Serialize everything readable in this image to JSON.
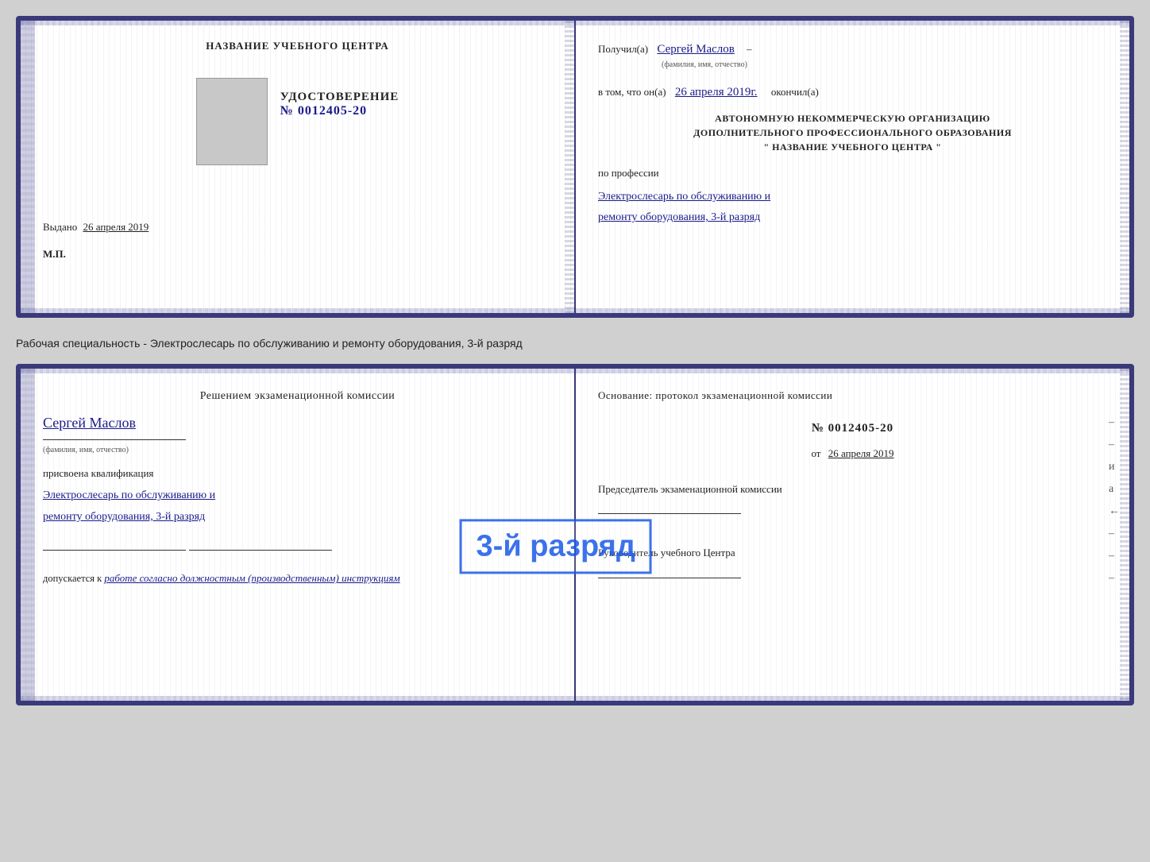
{
  "doc1": {
    "left": {
      "header": "НАЗВАНИЕ УЧЕБНОГО ЦЕНТРА",
      "udostoverenie_title": "УДОСТОВЕРЕНИЕ",
      "udostoverenie_number": "№ 0012405-20",
      "vydano_label": "Выдано",
      "vydano_date": "26 апреля 2019",
      "mp": "М.П."
    },
    "right": {
      "poluchil_label": "Получил(а)",
      "poluchil_name": "Сергей Маслов",
      "fio_label": "(фамилия, имя, отчество)",
      "vtom_label": "в том, что он(а)",
      "vtom_date": "26 апреля 2019г.",
      "okonchil": "окончил(а)",
      "org_line1": "АВТОНОМНУЮ НЕКОММЕРЧЕСКУЮ ОРГАНИЗАЦИЮ",
      "org_line2": "ДОПОЛНИТЕЛЬНОГО ПРОФЕССИОНАЛЬНОГО ОБРАЗОВАНИЯ",
      "org_line3": "\"   НАЗВАНИЕ УЧЕБНОГО ЦЕНТРА   \"",
      "po_professii": "по профессии",
      "profession_line1": "Электрослесарь по обслуживанию и",
      "profession_line2": "ремонту оборудования, 3-й разряд"
    }
  },
  "middle_label": "Рабочая специальность - Электрослесарь по обслуживанию и ремонту оборудования, 3-й разряд",
  "doc2": {
    "left": {
      "resheniem": "Решением экзаменационной комиссии",
      "name_handwritten": "Сергей Маслов",
      "fio_label": "(фамилия, имя, отчество)",
      "prisvoyena": "присвоена квалификация",
      "qualification_line1": "Электрослесарь по обслуживанию и",
      "qualification_line2": "ремонту оборудования, 3-й разряд",
      "dopuskaetsya": "допускается к",
      "dopusk_text": "работе согласно должностным (производственным) инструкциям"
    },
    "right": {
      "osnovanie": "Основание: протокол экзаменационной комиссии",
      "number": "№  0012405-20",
      "ot_label": "от",
      "ot_date": "26 апреля 2019",
      "predsedatel": "Председатель экзаменационной комиссии",
      "rukovoditel": "Руководитель учебного Центра"
    },
    "stamp": "3-й разряд"
  }
}
